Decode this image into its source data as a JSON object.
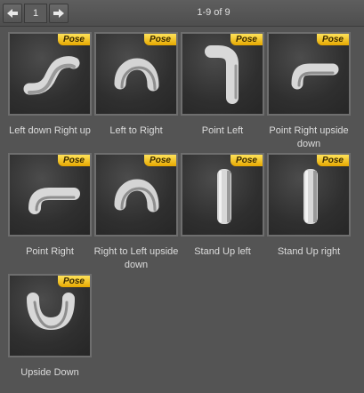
{
  "toolbar": {
    "page_number": "1",
    "range_text": "1-9 of 9"
  },
  "badge_label": "Pose",
  "items": [
    {
      "label": "Left down Right up",
      "icon": "pipe-s-bend"
    },
    {
      "label": "Left to Right",
      "icon": "pipe-arch"
    },
    {
      "label": "Point Left",
      "icon": "pipe-elbow-left"
    },
    {
      "label": "Point Right upside down",
      "icon": "pipe-elbow-right-down"
    },
    {
      "label": "Point Right",
      "icon": "pipe-elbow-right"
    },
    {
      "label": "Right to Left upside down",
      "icon": "pipe-arch"
    },
    {
      "label": "Stand Up left",
      "icon": "pipe-straight-vertical"
    },
    {
      "label": "Stand Up right",
      "icon": "pipe-straight-vertical"
    },
    {
      "label": "Upside Down",
      "icon": "pipe-u-bend"
    }
  ]
}
